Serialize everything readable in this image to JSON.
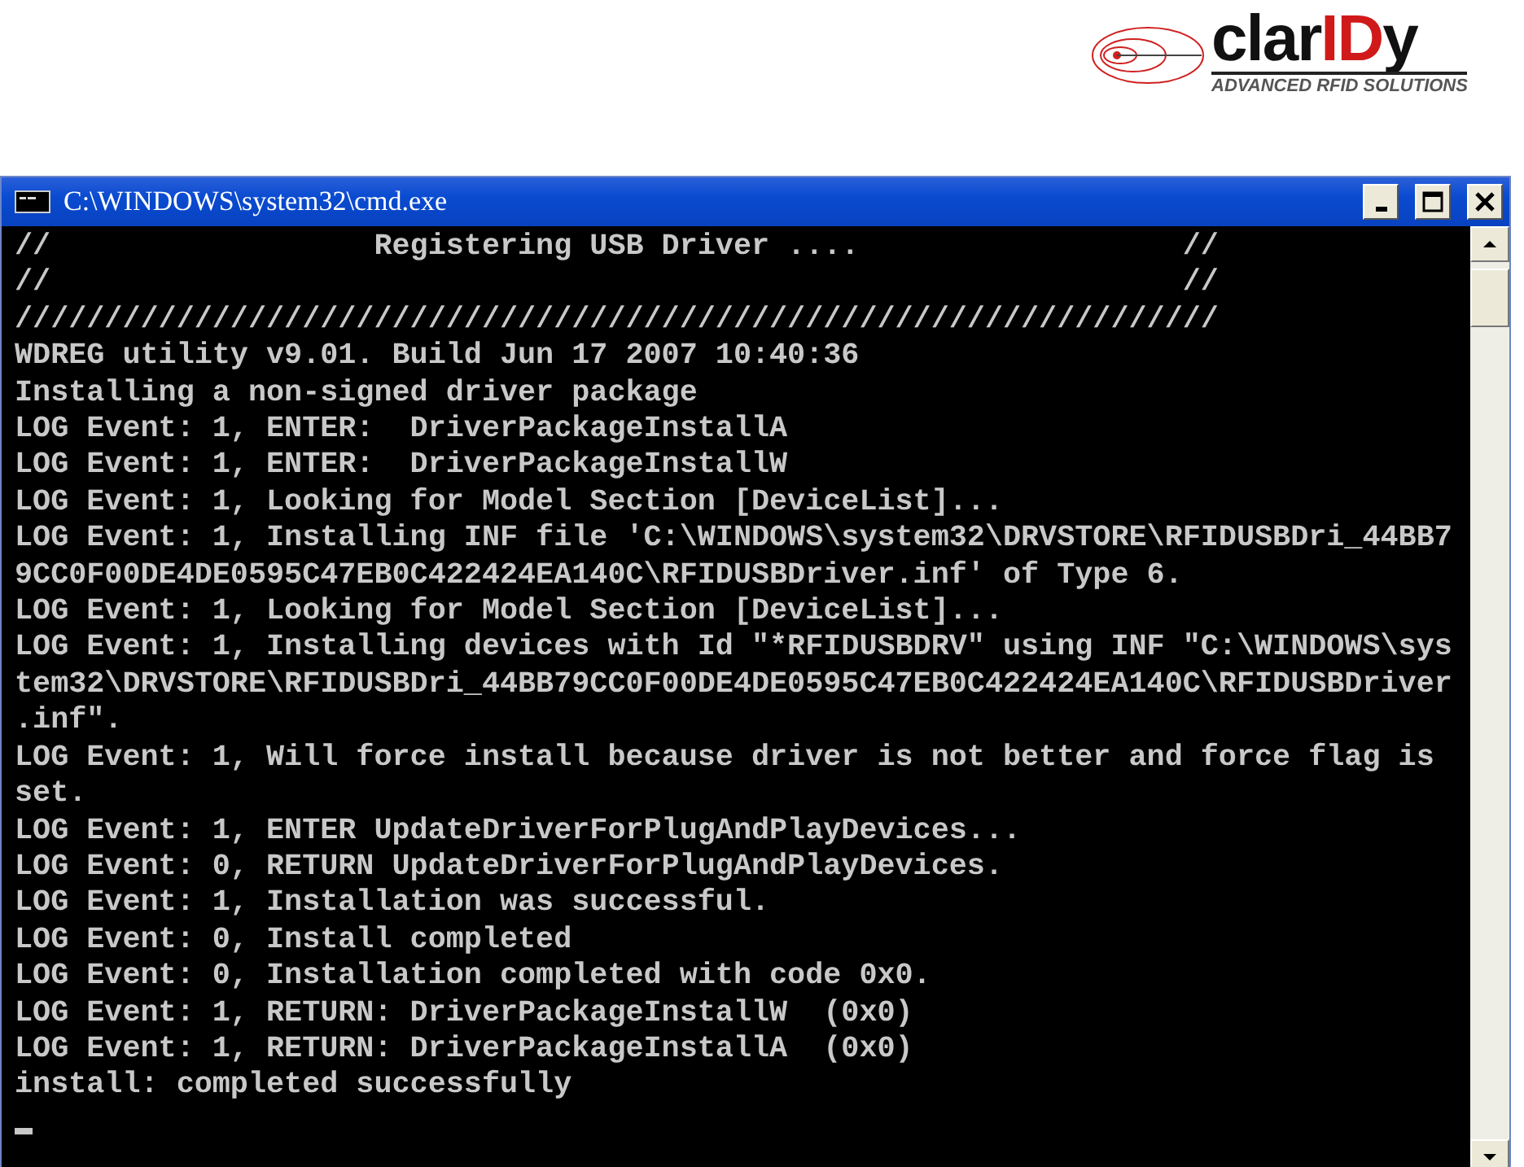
{
  "logo": {
    "name_parts": [
      {
        "text": "clar",
        "accent": false
      },
      {
        "text": "ID",
        "accent": true
      },
      {
        "text": "y",
        "accent": false
      }
    ],
    "tagline": "ADVANCED RFID SOLUTIONS"
  },
  "window": {
    "title": "C:\\WINDOWS\\system32\\cmd.exe",
    "lines": [
      "//                  Registering USB Driver ....                  //",
      "//                                                               //",
      "///////////////////////////////////////////////////////////////////",
      "WDREG utility v9.01. Build Jun 17 2007 10:40:36",
      "Installing a non-signed driver package",
      "LOG Event: 1, ENTER:  DriverPackageInstallA",
      "LOG Event: 1, ENTER:  DriverPackageInstallW",
      "LOG Event: 1, Looking for Model Section [DeviceList]...",
      "LOG Event: 1, Installing INF file 'C:\\WINDOWS\\system32\\DRVSTORE\\RFIDUSBDri_44BB7",
      "9CC0F00DE4DE0595C47EB0C422424EA140C\\RFIDUSBDriver.inf' of Type 6.",
      "LOG Event: 1, Looking for Model Section [DeviceList]...",
      "LOG Event: 1, Installing devices with Id \"*RFIDUSBDRV\" using INF \"C:\\WINDOWS\\sys",
      "tem32\\DRVSTORE\\RFIDUSBDri_44BB79CC0F00DE4DE0595C47EB0C422424EA140C\\RFIDUSBDriver",
      ".inf\".",
      "LOG Event: 1, Will force install because driver is not better and force flag is",
      "set.",
      "LOG Event: 1, ENTER UpdateDriverForPlugAndPlayDevices...",
      "LOG Event: 0, RETURN UpdateDriverForPlugAndPlayDevices.",
      "LOG Event: 1, Installation was successful.",
      "LOG Event: 0, Install completed",
      "LOG Event: 0, Installation completed with code 0x0.",
      "LOG Event: 1, RETURN: DriverPackageInstallW  (0x0)",
      "LOG Event: 1, RETURN: DriverPackageInstallA  (0x0)",
      "install: completed successfully"
    ]
  }
}
